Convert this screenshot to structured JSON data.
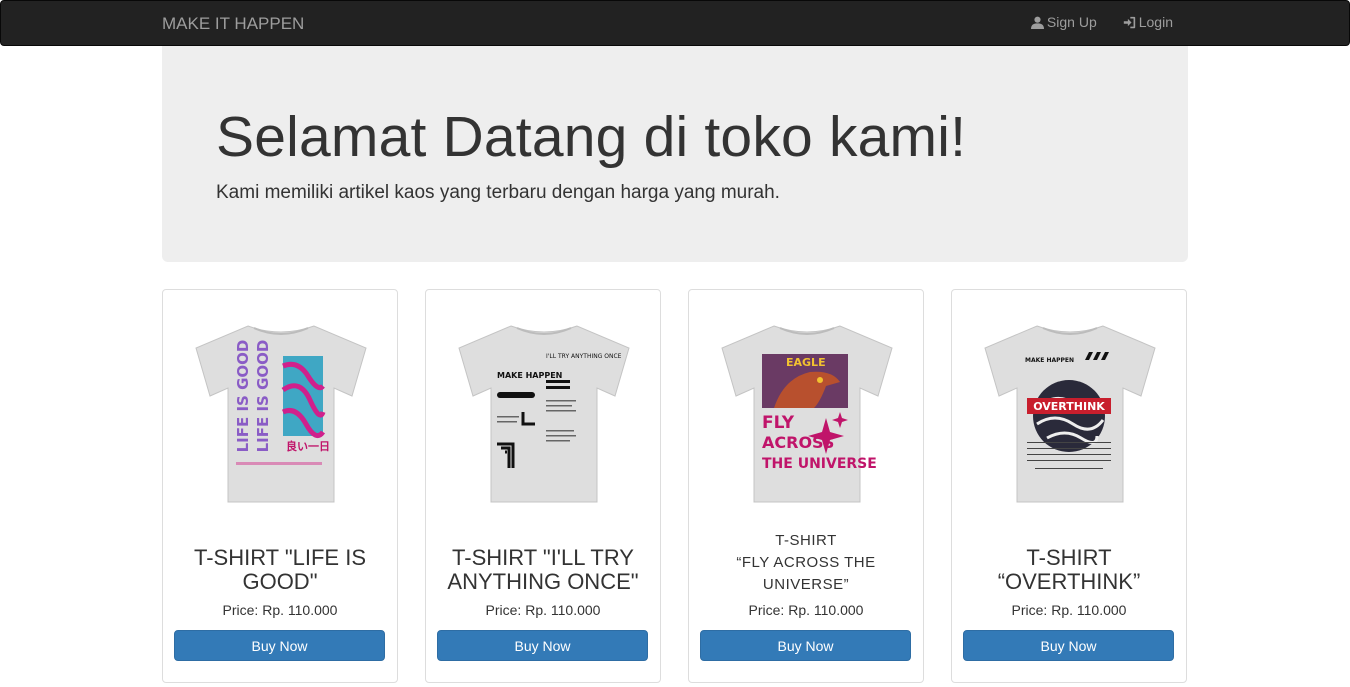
{
  "navbar": {
    "brand": "MAKE IT HAPPEN",
    "signup_label": "Sign Up",
    "login_label": "Login"
  },
  "jumbotron": {
    "title": "Selamat Datang di toko kami!",
    "lead": "Kami memiliki artikel kaos yang terbaru dengan harga yang murah."
  },
  "products": [
    {
      "name": "T-SHIRT \"LIFE IS GOOD\"",
      "price": "Price: Rp. 110.000",
      "buy_label": "Buy Now",
      "shirt_text": [
        "LIFE IS GOOD",
        "良い一日"
      ],
      "accent": "#c0146a"
    },
    {
      "name": "T-SHIRT \"I'LL TRY ANYTHING ONCE\"",
      "price": "Price: Rp. 110.000",
      "buy_label": "Buy Now",
      "shirt_text": [
        "MAKE HAPPEN",
        "I'LL TRY ANYTHING ONCE"
      ],
      "accent": "#111111"
    },
    {
      "name_lines": [
        "T-SHIRT",
        "“FLY ACROSS THE",
        "UNIVERSE”"
      ],
      "price": "Price: Rp. 110.000",
      "buy_label": "Buy Now",
      "shirt_text": [
        "EAGLE",
        "FLY",
        "ACROSS",
        "THE UNIVERSE"
      ],
      "accent": "#c0146a"
    },
    {
      "name": "T-SHIRT “OVERTHINK”",
      "price": "Price: Rp. 110.000",
      "buy_label": "Buy Now",
      "shirt_text": [
        "MAKE HAPPEN",
        "OVERTHINK"
      ],
      "accent": "#c81e2d"
    }
  ],
  "colors": {
    "navbar_bg": "#222222",
    "jumbotron_bg": "#eeeeee",
    "button_primary": "#337ab7"
  }
}
